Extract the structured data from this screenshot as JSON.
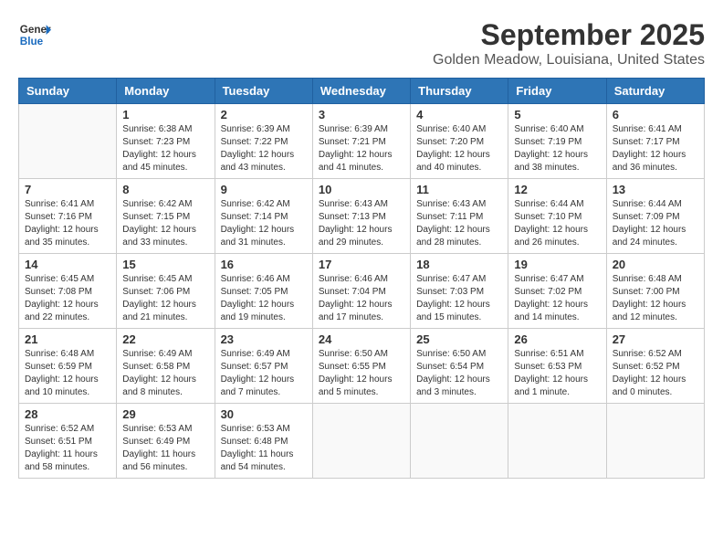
{
  "header": {
    "logo_line1": "General",
    "logo_line2": "Blue",
    "month": "September 2025",
    "location": "Golden Meadow, Louisiana, United States"
  },
  "weekdays": [
    "Sunday",
    "Monday",
    "Tuesday",
    "Wednesday",
    "Thursday",
    "Friday",
    "Saturday"
  ],
  "weeks": [
    [
      {
        "day": "",
        "info": ""
      },
      {
        "day": "1",
        "info": "Sunrise: 6:38 AM\nSunset: 7:23 PM\nDaylight: 12 hours\nand 45 minutes."
      },
      {
        "day": "2",
        "info": "Sunrise: 6:39 AM\nSunset: 7:22 PM\nDaylight: 12 hours\nand 43 minutes."
      },
      {
        "day": "3",
        "info": "Sunrise: 6:39 AM\nSunset: 7:21 PM\nDaylight: 12 hours\nand 41 minutes."
      },
      {
        "day": "4",
        "info": "Sunrise: 6:40 AM\nSunset: 7:20 PM\nDaylight: 12 hours\nand 40 minutes."
      },
      {
        "day": "5",
        "info": "Sunrise: 6:40 AM\nSunset: 7:19 PM\nDaylight: 12 hours\nand 38 minutes."
      },
      {
        "day": "6",
        "info": "Sunrise: 6:41 AM\nSunset: 7:17 PM\nDaylight: 12 hours\nand 36 minutes."
      }
    ],
    [
      {
        "day": "7",
        "info": "Sunrise: 6:41 AM\nSunset: 7:16 PM\nDaylight: 12 hours\nand 35 minutes."
      },
      {
        "day": "8",
        "info": "Sunrise: 6:42 AM\nSunset: 7:15 PM\nDaylight: 12 hours\nand 33 minutes."
      },
      {
        "day": "9",
        "info": "Sunrise: 6:42 AM\nSunset: 7:14 PM\nDaylight: 12 hours\nand 31 minutes."
      },
      {
        "day": "10",
        "info": "Sunrise: 6:43 AM\nSunset: 7:13 PM\nDaylight: 12 hours\nand 29 minutes."
      },
      {
        "day": "11",
        "info": "Sunrise: 6:43 AM\nSunset: 7:11 PM\nDaylight: 12 hours\nand 28 minutes."
      },
      {
        "day": "12",
        "info": "Sunrise: 6:44 AM\nSunset: 7:10 PM\nDaylight: 12 hours\nand 26 minutes."
      },
      {
        "day": "13",
        "info": "Sunrise: 6:44 AM\nSunset: 7:09 PM\nDaylight: 12 hours\nand 24 minutes."
      }
    ],
    [
      {
        "day": "14",
        "info": "Sunrise: 6:45 AM\nSunset: 7:08 PM\nDaylight: 12 hours\nand 22 minutes."
      },
      {
        "day": "15",
        "info": "Sunrise: 6:45 AM\nSunset: 7:06 PM\nDaylight: 12 hours\nand 21 minutes."
      },
      {
        "day": "16",
        "info": "Sunrise: 6:46 AM\nSunset: 7:05 PM\nDaylight: 12 hours\nand 19 minutes."
      },
      {
        "day": "17",
        "info": "Sunrise: 6:46 AM\nSunset: 7:04 PM\nDaylight: 12 hours\nand 17 minutes."
      },
      {
        "day": "18",
        "info": "Sunrise: 6:47 AM\nSunset: 7:03 PM\nDaylight: 12 hours\nand 15 minutes."
      },
      {
        "day": "19",
        "info": "Sunrise: 6:47 AM\nSunset: 7:02 PM\nDaylight: 12 hours\nand 14 minutes."
      },
      {
        "day": "20",
        "info": "Sunrise: 6:48 AM\nSunset: 7:00 PM\nDaylight: 12 hours\nand 12 minutes."
      }
    ],
    [
      {
        "day": "21",
        "info": "Sunrise: 6:48 AM\nSunset: 6:59 PM\nDaylight: 12 hours\nand 10 minutes."
      },
      {
        "day": "22",
        "info": "Sunrise: 6:49 AM\nSunset: 6:58 PM\nDaylight: 12 hours\nand 8 minutes."
      },
      {
        "day": "23",
        "info": "Sunrise: 6:49 AM\nSunset: 6:57 PM\nDaylight: 12 hours\nand 7 minutes."
      },
      {
        "day": "24",
        "info": "Sunrise: 6:50 AM\nSunset: 6:55 PM\nDaylight: 12 hours\nand 5 minutes."
      },
      {
        "day": "25",
        "info": "Sunrise: 6:50 AM\nSunset: 6:54 PM\nDaylight: 12 hours\nand 3 minutes."
      },
      {
        "day": "26",
        "info": "Sunrise: 6:51 AM\nSunset: 6:53 PM\nDaylight: 12 hours\nand 1 minute."
      },
      {
        "day": "27",
        "info": "Sunrise: 6:52 AM\nSunset: 6:52 PM\nDaylight: 12 hours\nand 0 minutes."
      }
    ],
    [
      {
        "day": "28",
        "info": "Sunrise: 6:52 AM\nSunset: 6:51 PM\nDaylight: 11 hours\nand 58 minutes."
      },
      {
        "day": "29",
        "info": "Sunrise: 6:53 AM\nSunset: 6:49 PM\nDaylight: 11 hours\nand 56 minutes."
      },
      {
        "day": "30",
        "info": "Sunrise: 6:53 AM\nSunset: 6:48 PM\nDaylight: 11 hours\nand 54 minutes."
      },
      {
        "day": "",
        "info": ""
      },
      {
        "day": "",
        "info": ""
      },
      {
        "day": "",
        "info": ""
      },
      {
        "day": "",
        "info": ""
      }
    ]
  ]
}
